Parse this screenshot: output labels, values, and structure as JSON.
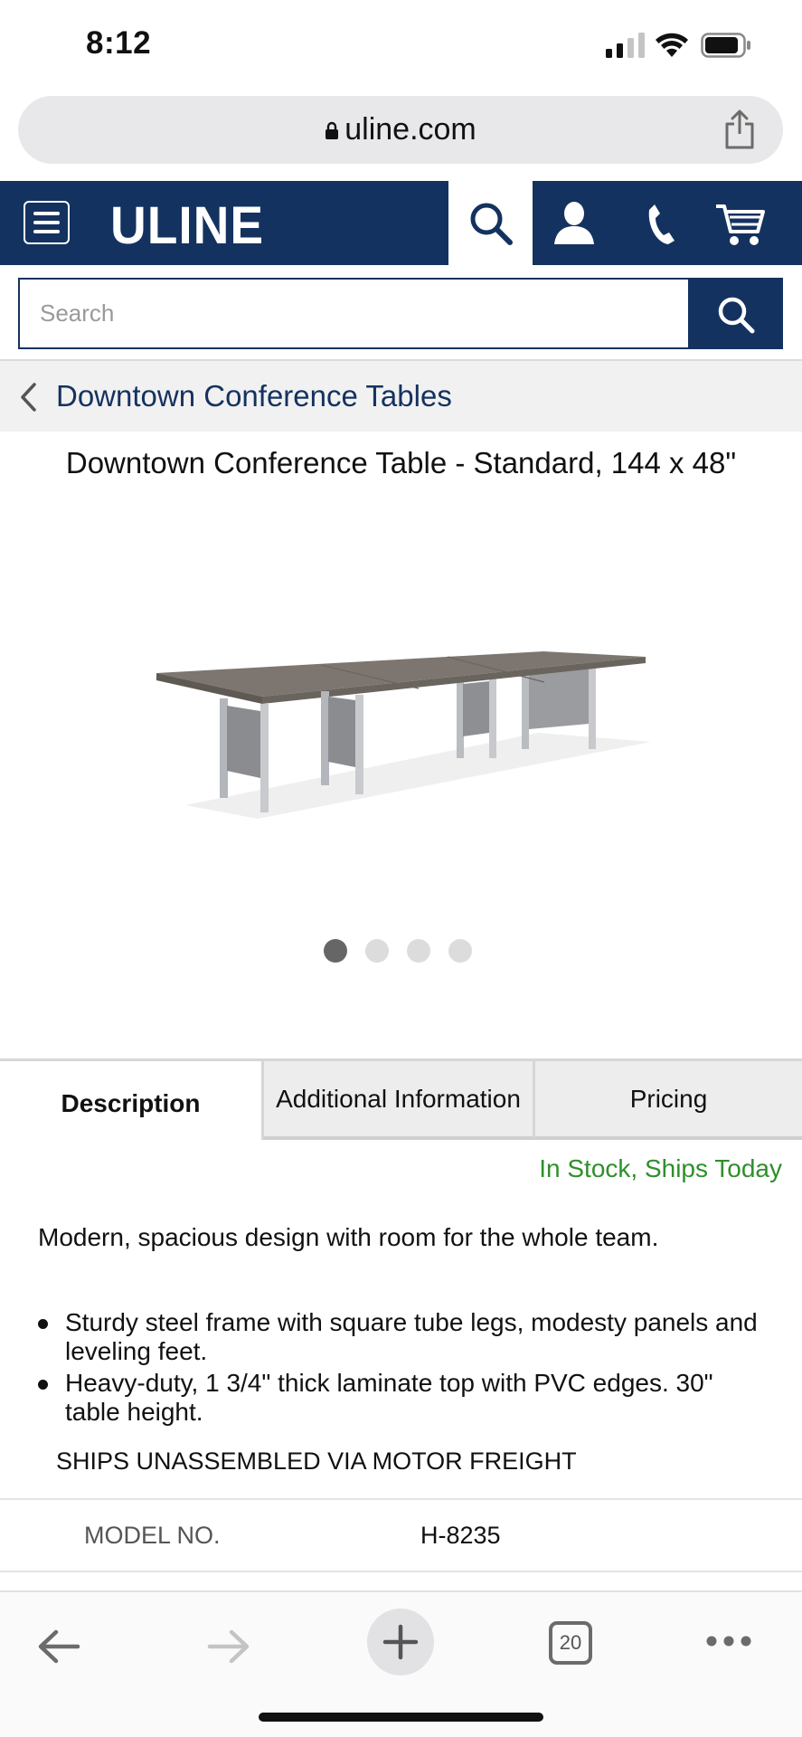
{
  "status_bar": {
    "time": "8:12"
  },
  "browser": {
    "url": "uline.com"
  },
  "header": {
    "logo": "ULINE"
  },
  "search": {
    "placeholder": "Search"
  },
  "breadcrumb": {
    "label": "Downtown Conference Tables"
  },
  "product": {
    "title": "Downtown Conference Table - Standard, 144 x 48\"",
    "carousel": {
      "count": 4,
      "active_index": 0
    }
  },
  "tabs": [
    {
      "label": "Description",
      "active": true
    },
    {
      "label": "Additional Information",
      "active": false
    },
    {
      "label": "Pricing",
      "active": false
    }
  ],
  "description": {
    "stock": "In Stock, Ships Today",
    "lead": "Modern, spacious design with room for the whole team.",
    "bullets": [
      "Sturdy steel frame with square tube legs, modesty panels and leveling feet.",
      "Heavy-duty, 1 3/4\" thick laminate top with PVC edges. 30\" table height."
    ],
    "shipping_note": "SHIPS UNASSEMBLED VIA MOTOR FREIGHT"
  },
  "specs": {
    "model_label": "MODEL NO.",
    "model_value": "H-8235"
  },
  "toolbar": {
    "tab_count": "20"
  },
  "colors": {
    "brand_navy": "#14325f",
    "stock_green": "#2f8f2b"
  },
  "icons": [
    "lock-icon",
    "share-icon",
    "menu-icon",
    "search-icon",
    "user-icon",
    "phone-icon",
    "cart-icon",
    "chevron-left-icon",
    "back-arrow-icon",
    "forward-arrow-icon",
    "plus-icon",
    "tabs-icon",
    "more-icon"
  ]
}
